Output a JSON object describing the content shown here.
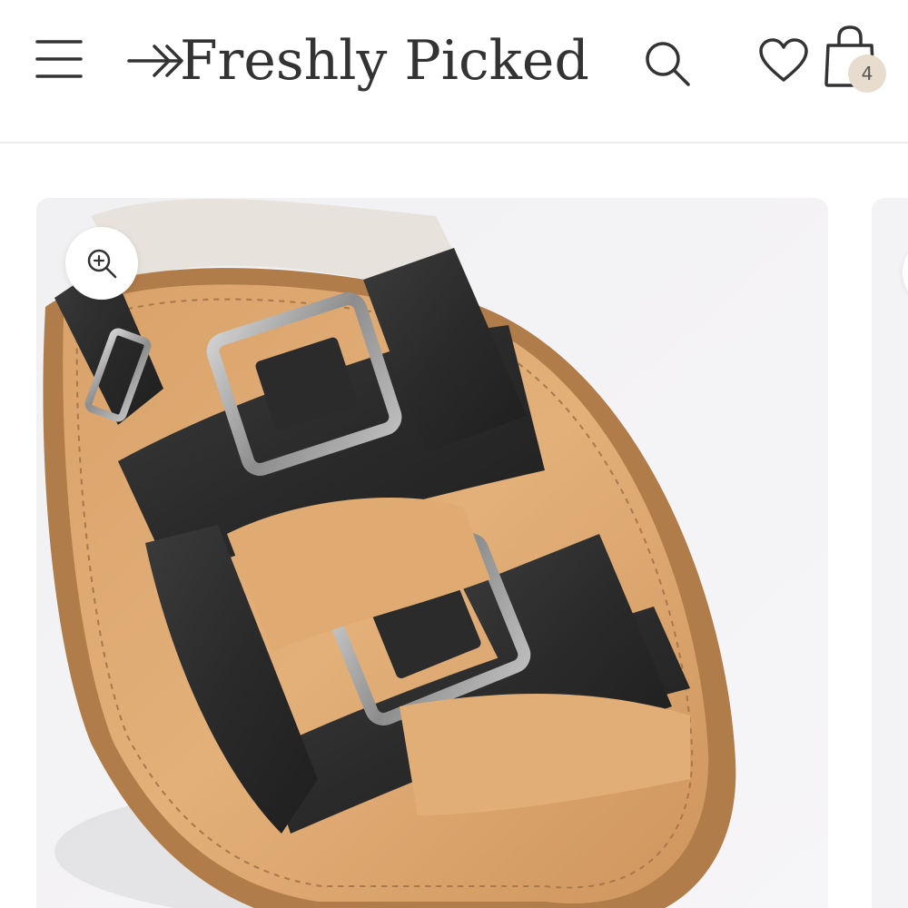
{
  "header": {
    "brand_name": "Freshly Picked",
    "cart_count": "4"
  },
  "icons": {
    "menu": "hamburger-menu-icon",
    "logo_arrow": "double-arrow-icon",
    "search": "search-icon",
    "wishlist": "heart-icon",
    "cart": "shopping-bag-icon",
    "zoom": "zoom-in-icon"
  },
  "product_gallery": {
    "image_subject": "black leather two-buckle sandal"
  },
  "colors": {
    "text": "#333333",
    "badge": "#e7dccd",
    "card_bg": "#f3f2f4"
  }
}
